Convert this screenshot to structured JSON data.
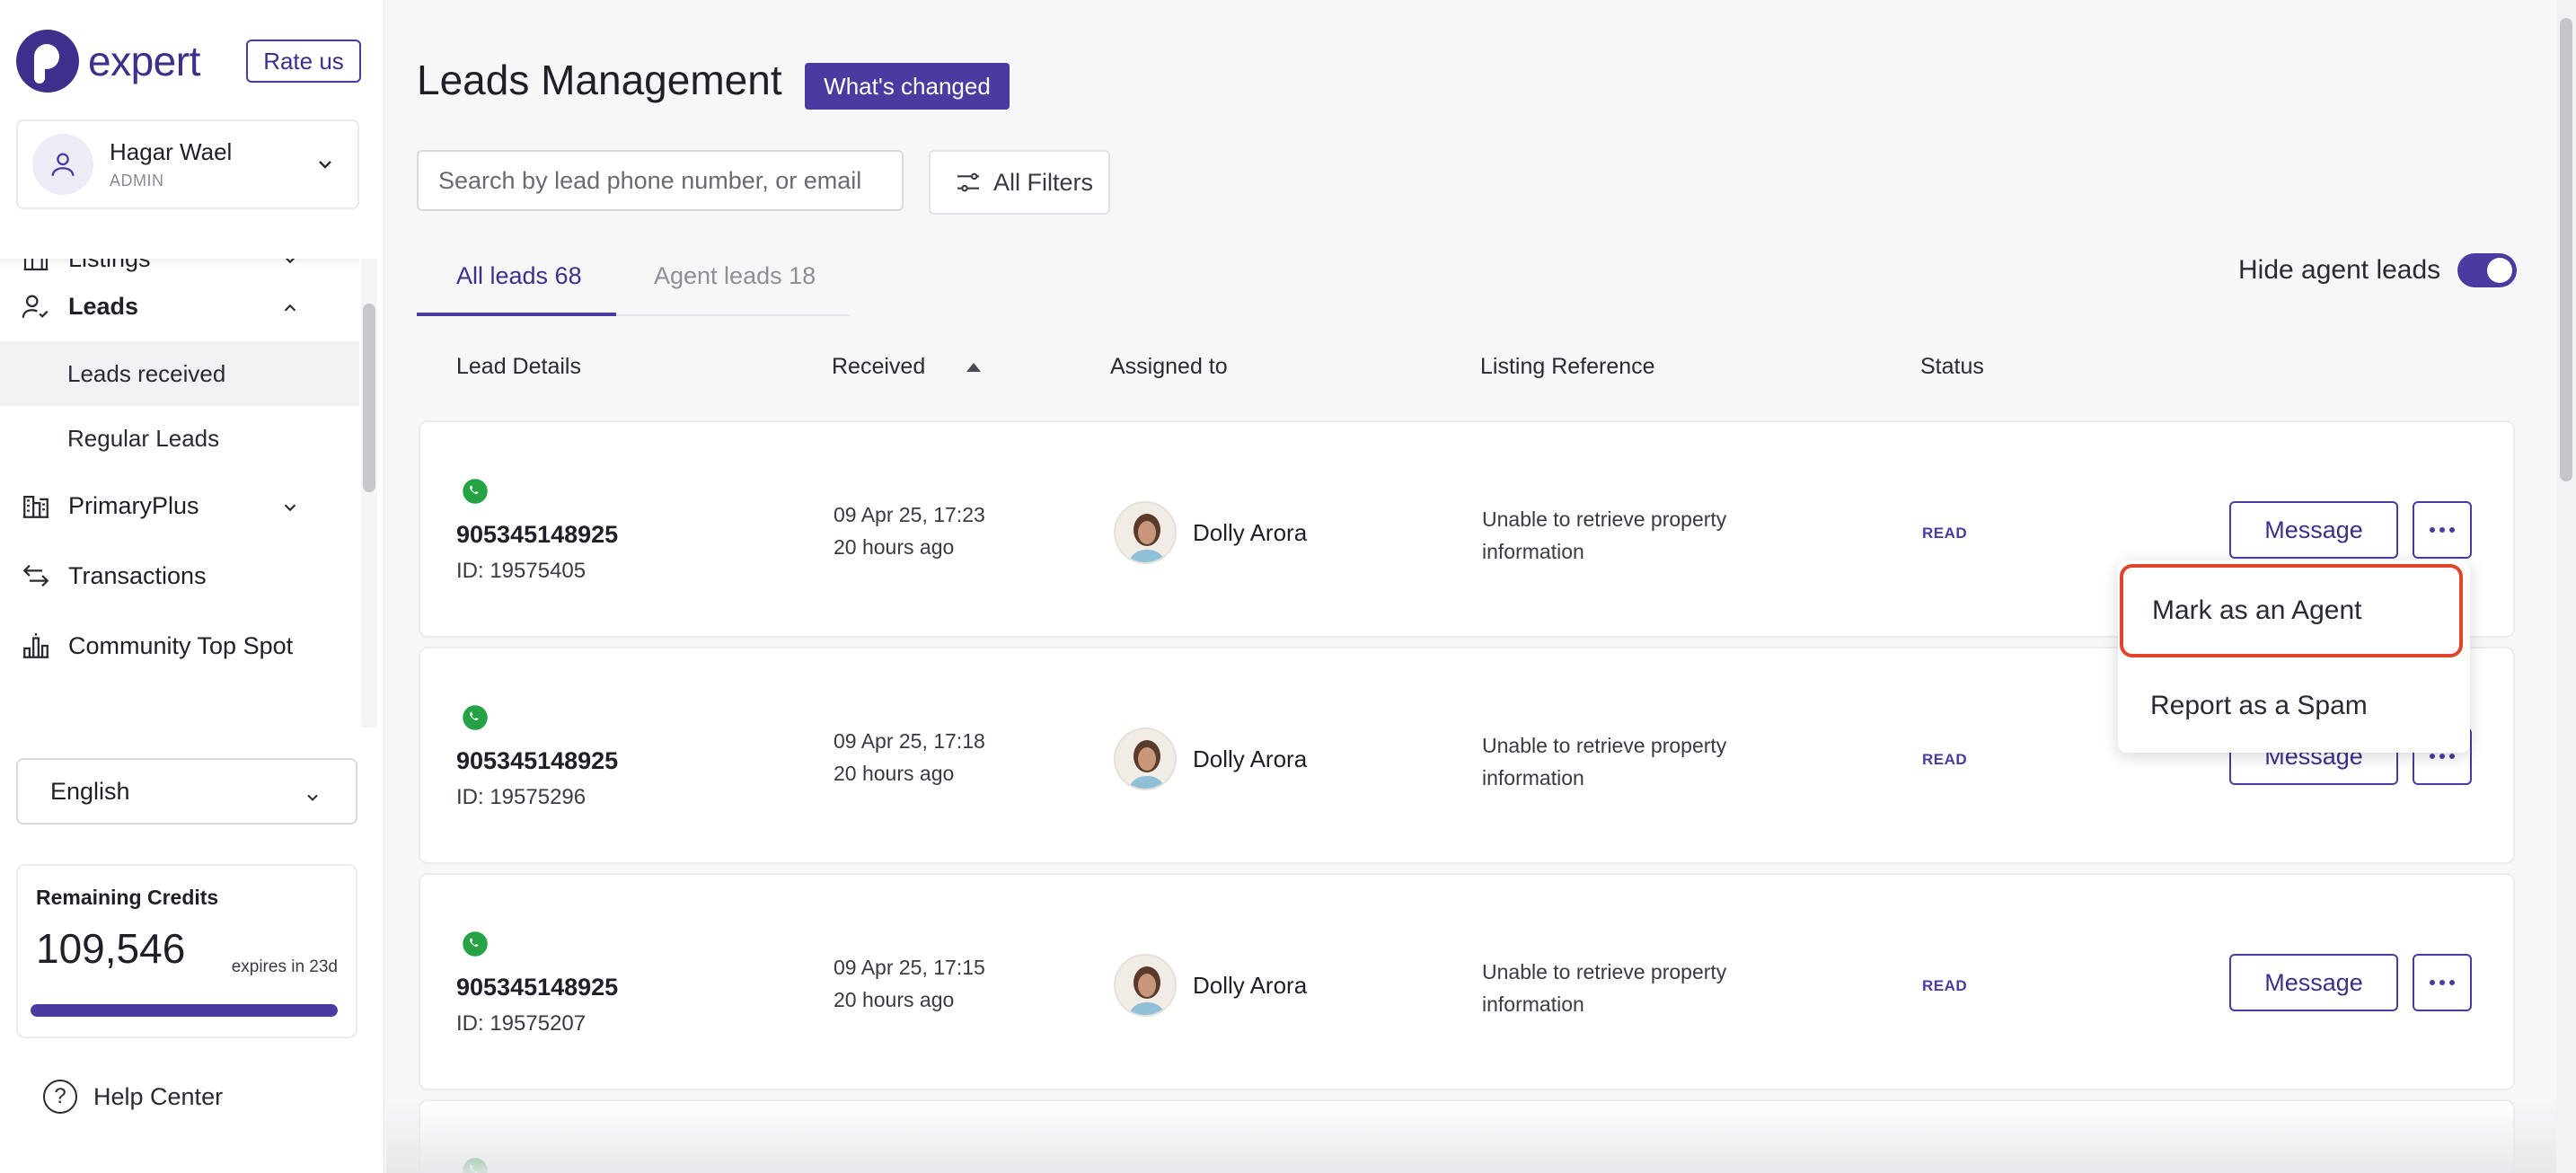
{
  "brand": {
    "name": "expert",
    "rate_label": "Rate us"
  },
  "user": {
    "name": "Hagar Wael",
    "role": "ADMIN"
  },
  "sidebar": {
    "items": [
      {
        "label": "Listings",
        "icon": "building-icon"
      },
      {
        "label": "Leads",
        "icon": "person-icon"
      },
      {
        "label": "Leads received"
      },
      {
        "label": "Regular Leads"
      },
      {
        "label": "PrimaryPlus",
        "icon": "city-icon"
      },
      {
        "label": "Transactions",
        "icon": "exchange-icon"
      },
      {
        "label": "Community Top Spot",
        "icon": "chart-bars-icon"
      }
    ],
    "language": "English",
    "credits": {
      "label": "Remaining Credits",
      "value": "109,546",
      "expires": "expires in 23d",
      "fill_fraction": 1.0
    },
    "help_label": "Help Center"
  },
  "main": {
    "title": "Leads Management",
    "changed_label": "What's changed",
    "search_placeholder": "Search by lead phone number, or email",
    "filters_label": "All Filters",
    "tabs": [
      {
        "label": "All leads 68",
        "active": true
      },
      {
        "label": "Agent leads 18",
        "active": false
      }
    ],
    "hide_agent_label": "Hide agent leads",
    "hide_agent_on": true,
    "columns": [
      "Lead Details",
      "Received",
      "Assigned to",
      "Listing Reference",
      "Status"
    ],
    "rows": [
      {
        "phone": "905345148925",
        "id": "ID: 19575405",
        "date": "09 Apr 25, 17:23",
        "ago": "20 hours ago",
        "agent": "Dolly Arora",
        "listing": "Unable to retrieve property information",
        "status": "READ",
        "message_label": "Message"
      },
      {
        "phone": "905345148925",
        "id": "ID: 19575296",
        "date": "09 Apr 25, 17:18",
        "ago": "20 hours ago",
        "agent": "Dolly Arora",
        "listing": "Unable to retrieve property information",
        "status": "READ",
        "message_label": "Message"
      },
      {
        "phone": "905345148925",
        "id": "ID: 19575207",
        "date": "09 Apr 25, 17:15",
        "ago": "20 hours ago",
        "agent": "Dolly Arora",
        "listing": "Unable to retrieve property information",
        "status": "READ",
        "message_label": "Message"
      }
    ],
    "menu": [
      "Mark as an Agent",
      "Report as a Spam"
    ]
  },
  "colors": {
    "accent": "#4b3aa0",
    "highlight": "#e0442b",
    "whatsapp": "#25a244"
  }
}
